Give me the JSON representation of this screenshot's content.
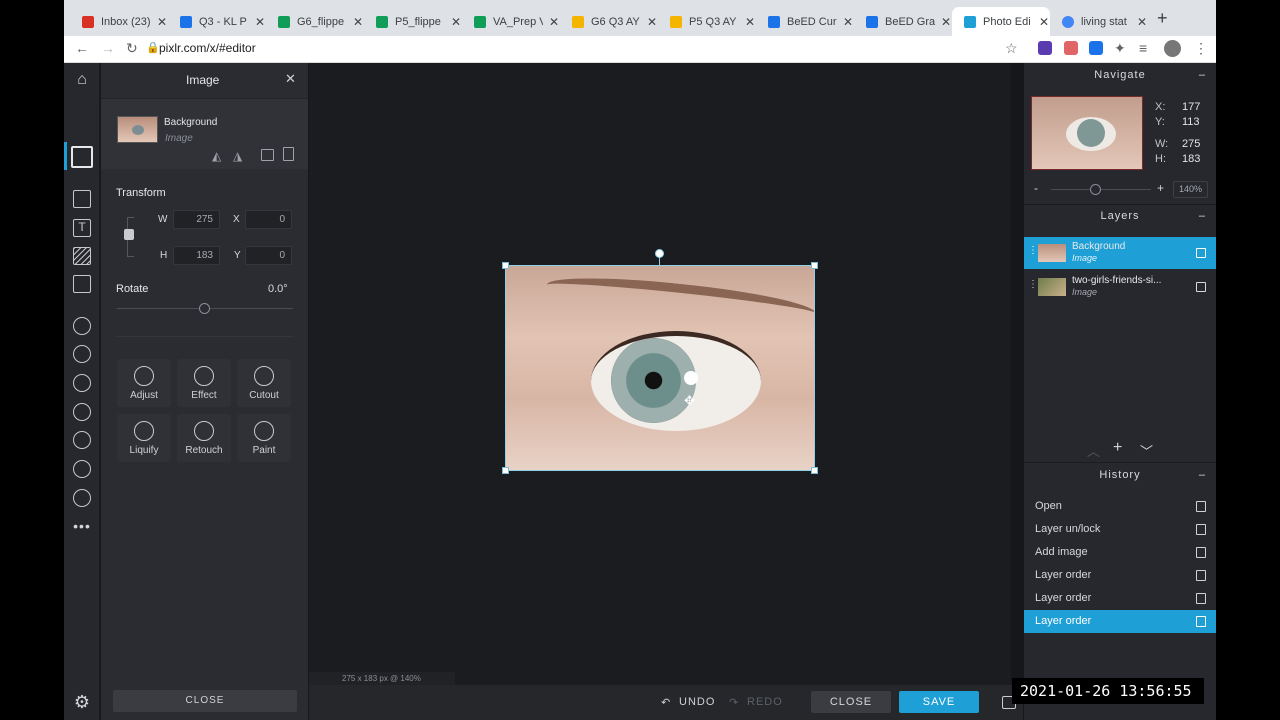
{
  "browser": {
    "tabs": [
      {
        "title": "Inbox (23)",
        "color": "#d93025"
      },
      {
        "title": "Q3 - KL P",
        "color": "#1a73e8"
      },
      {
        "title": "G6_flippe",
        "color": "#0f9d58"
      },
      {
        "title": "P5_flippe",
        "color": "#0f9d58"
      },
      {
        "title": "VA_Prep V",
        "color": "#0f9d58"
      },
      {
        "title": "G6 Q3 AY",
        "color": "#f4b400"
      },
      {
        "title": "P5 Q3 AY",
        "color": "#f4b400"
      },
      {
        "title": "BeED Cur",
        "color": "#1a73e8"
      },
      {
        "title": "BeED Gra",
        "color": "#1a73e8"
      },
      {
        "title": "Photo Edi",
        "color": "#1e9fd6"
      },
      {
        "title": "living stat",
        "color": "#4285f4"
      }
    ],
    "url": "pixlr.com/x/#editor"
  },
  "left_panel": {
    "title": "Image",
    "layer_name": "Background",
    "layer_type": "Image",
    "transform_label": "Transform",
    "w_label": "W",
    "w_value": "275",
    "h_label": "H",
    "h_value": "183",
    "x_label": "X",
    "x_value": "0",
    "y_label": "Y",
    "y_value": "0",
    "rotate_label": "Rotate",
    "rotate_value": "0.0°",
    "tools": [
      "Adjust",
      "Effect",
      "Cutout",
      "Liquify",
      "Retouch",
      "Paint"
    ],
    "close_label": "CLOSE"
  },
  "canvas": {
    "status": "275 x 183 px @ 140%"
  },
  "bottom": {
    "undo": "UNDO",
    "redo": "REDO",
    "close": "CLOSE",
    "save": "SAVE"
  },
  "navigate": {
    "title": "Navigate",
    "x_label": "X:",
    "x_value": "177",
    "y_label": "Y:",
    "y_value": "113",
    "w_label": "W:",
    "w_value": "275",
    "h_label": "H:",
    "h_value": "183",
    "zoom": "140%"
  },
  "layers": {
    "title": "Layers",
    "items": [
      {
        "name": "Background",
        "type": "Image"
      },
      {
        "name": "two-girls-friends-si...",
        "type": "Image"
      }
    ]
  },
  "history": {
    "title": "History",
    "items": [
      "Open",
      "Layer un/lock",
      "Add image",
      "Layer order",
      "Layer order",
      "Layer order"
    ]
  },
  "timestamp": "2021-01-26 13:56:55",
  "colors": {
    "accent": "#1e9fd6",
    "panel": "#2a2c31",
    "canvas": "#1b1c20"
  }
}
